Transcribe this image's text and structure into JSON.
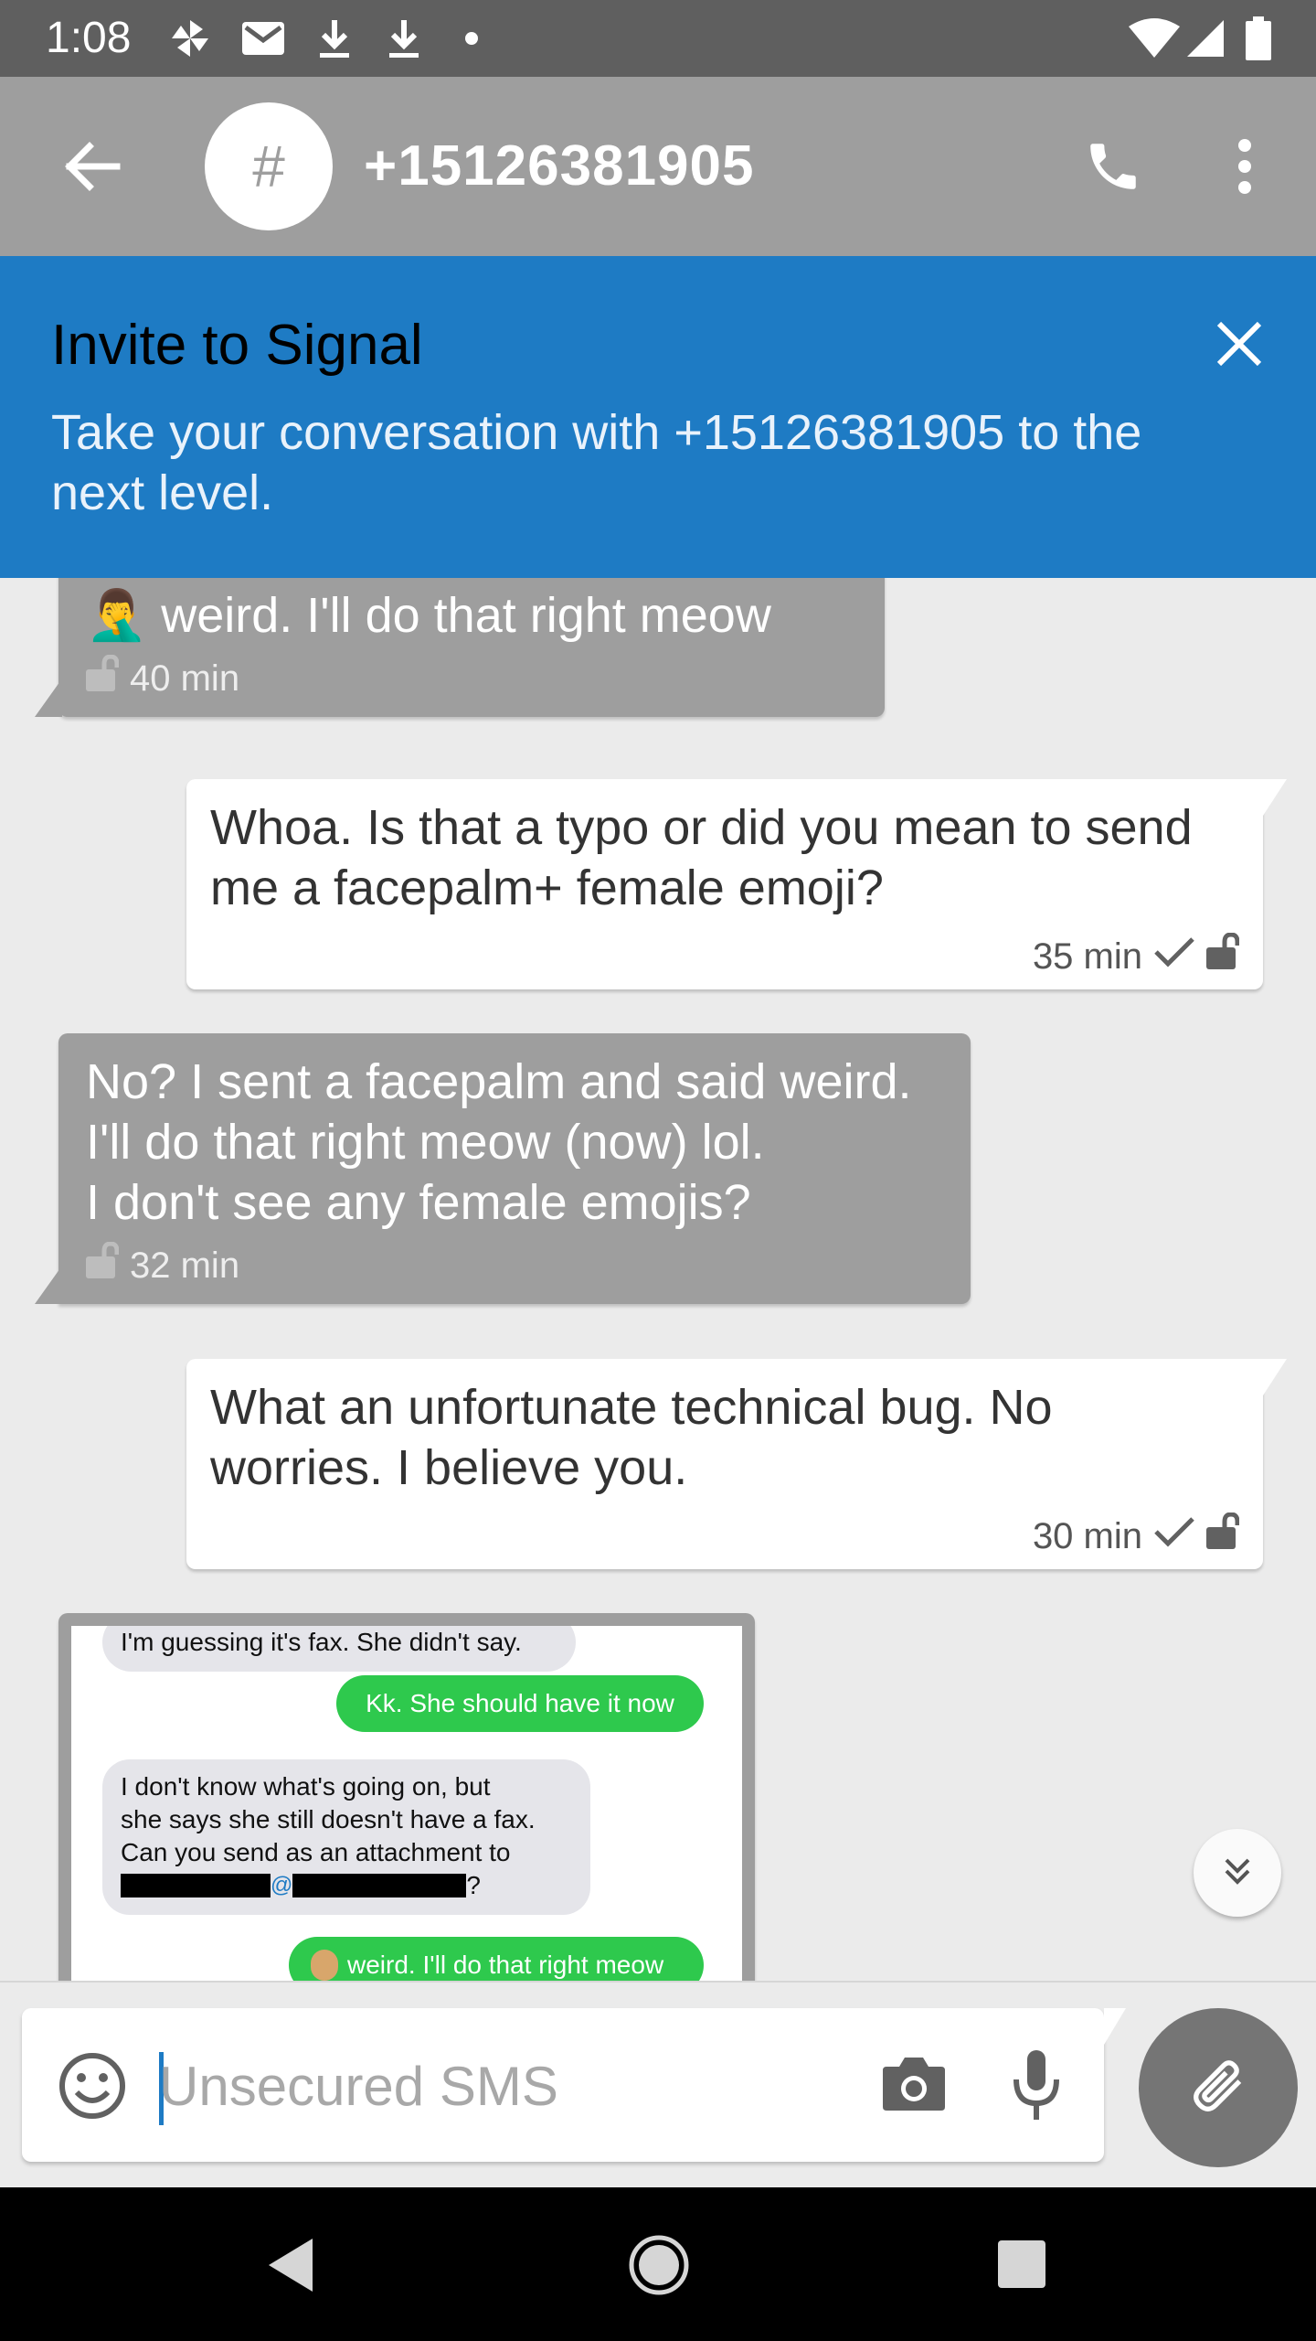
{
  "status_bar": {
    "time": "1:08",
    "notification_icons": [
      "pinwheel-icon",
      "gmail-icon",
      "download-icon",
      "download-icon",
      "dot-icon"
    ],
    "system_icons": [
      "wifi-icon",
      "signal-icon",
      "battery-icon"
    ]
  },
  "app_bar": {
    "avatar_text": "#",
    "title": "+15126381905",
    "icons": [
      "back-arrow-icon",
      "phone-icon",
      "more-vert-icon"
    ]
  },
  "banner": {
    "title": "Invite to Signal",
    "body": "Take your conversation with +15126381905 to the next level.",
    "close_icon": "close-icon"
  },
  "messages": [
    {
      "direction": "incoming",
      "text": "🤦‍♂️ weird. I'll do that right meow",
      "time": "40 min"
    },
    {
      "direction": "outgoing",
      "lines": [
        "Whoa. Is that a typo or did you mean to send",
        "me a facepalm+ female emoji?"
      ],
      "time": "35 min"
    },
    {
      "direction": "incoming",
      "lines": [
        "No? I sent a facepalm and said weird.",
        "I'll do that right meow (now) lol.",
        "I don't see any female emojis?"
      ],
      "time": "32 min"
    },
    {
      "direction": "outgoing",
      "lines": [
        "What an unfortunate technical bug. No",
        "worries. I believe you."
      ],
      "time": "30 min"
    }
  ],
  "image_message": {
    "bubbles": [
      {
        "side": "left",
        "text": "I'm guessing it's fax. She didn't say."
      },
      {
        "side": "right",
        "text": "Kk. She should have it now"
      },
      {
        "side": "left",
        "lines": [
          "I don't know what's going on, but",
          "she says she still doesn't have a fax.",
          "Can you send as an attachment to",
          "?"
        ],
        "at_sign": "@"
      },
      {
        "side": "right",
        "text": "weird. I'll do that right meow"
      }
    ]
  },
  "composer": {
    "placeholder": "Unsecured SMS",
    "icons": [
      "emoji-icon",
      "camera-icon",
      "microphone-icon",
      "attachment-icon"
    ]
  },
  "colors": {
    "status_bar": "#5f5f5f",
    "app_bar": "#9e9e9e",
    "banner": "#1e7bc4",
    "incoming_bubble": "#9e9e9e",
    "outgoing_bubble": "#ffffff",
    "sms_green": "#2ec94d",
    "attach_button": "#757575"
  }
}
